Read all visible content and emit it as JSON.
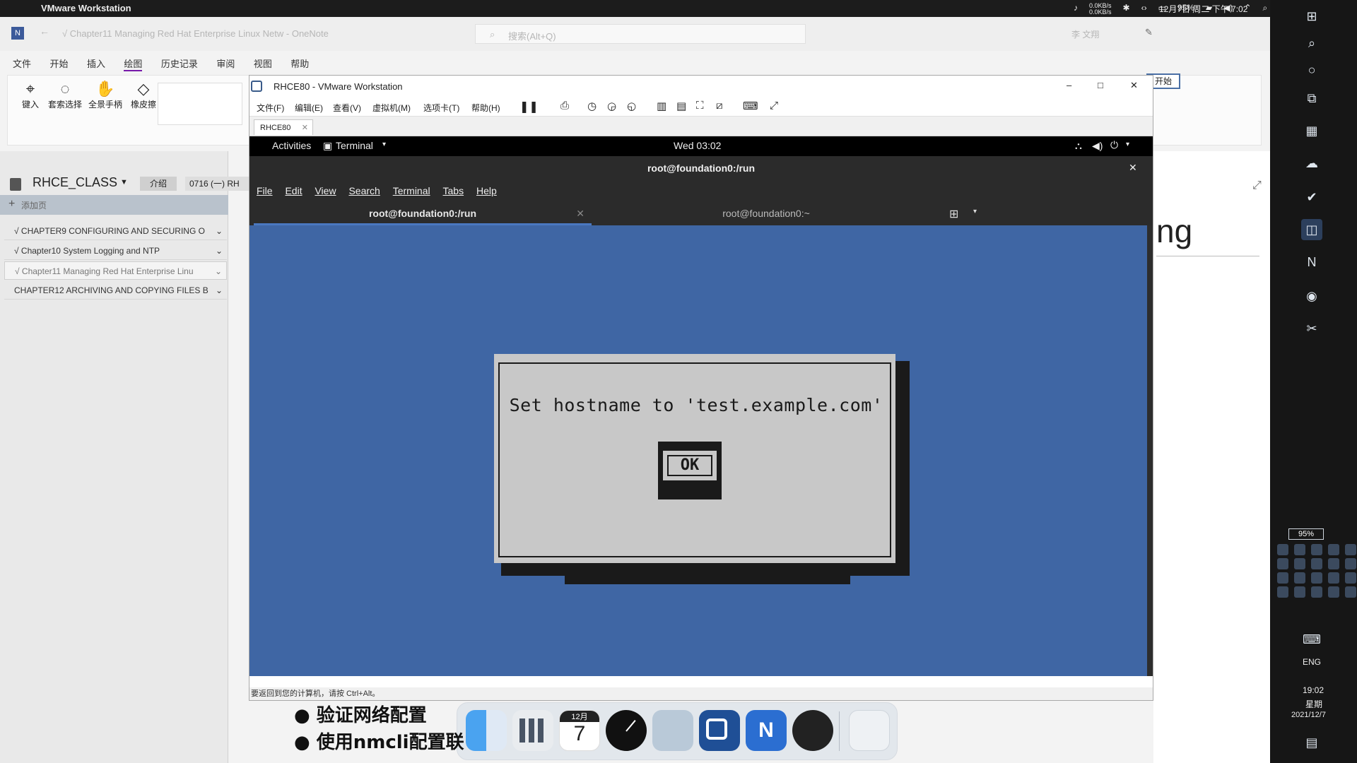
{
  "macbar": {
    "app_name": "VMware Workstation",
    "net_up": "0.0KB/s",
    "net_down": "0.0KB/s",
    "battery": "95%",
    "datetime": "12月7日 周二 下午 7:02"
  },
  "onenote": {
    "window_title": "√ Chapter11 Managing Red Hat Enterprise Linux Netw - OneNote",
    "search_placeholder": "搜索(Alt+Q)",
    "user": "李 文翔",
    "menu": [
      "文件",
      "开始",
      "插入",
      "绘图",
      "历史记录",
      "审阅",
      "视图",
      "帮助"
    ],
    "ribbon_tools": [
      "键入",
      "套索选择",
      "全景手柄",
      "橡皮擦"
    ],
    "notebook": "RHCE_CLASS",
    "section_tabs": [
      "介绍",
      "0716 (一) RH"
    ],
    "add_page": "添加页",
    "sections": [
      "√ CHAPTER9 CONFIGURING AND SECURING O",
      "√ Chapter10 System Logging and NTP",
      "√ Chapter11 Managing Red Hat Enterprise Linu",
      "CHAPTER12 ARCHIVING AND COPYING FILES B"
    ],
    "page_fragment": "ng",
    "start_button": "开始"
  },
  "vmware": {
    "title": "RHCE80 - VMware Workstation",
    "menu": [
      "文件(F)",
      "编辑(E)",
      "查看(V)",
      "虚拟机(M)",
      "选项卡(T)",
      "帮助(H)"
    ],
    "vm_tab": "RHCE80",
    "status_text": "要返回到您的计算机，请按 Ctrl+Alt。"
  },
  "guest": {
    "activities": "Activities",
    "app_menu": "Terminal",
    "clock": "Wed 03:02",
    "terminal_title": "root@foundation0:/run",
    "terminal_menu": [
      "File",
      "Edit",
      "View",
      "Search",
      "Terminal",
      "Tabs",
      "Help"
    ],
    "tabs": [
      "root@foundation0:/run",
      "root@foundation0:~"
    ],
    "dialog_message": "Set hostname to 'test.example.com'",
    "ok_label": "OK"
  },
  "dock": {
    "calendar_month": "12月",
    "calendar_day": "7"
  },
  "subtitles": [
    "验证网络配置",
    "使用nmcli配置联"
  ],
  "taskbar": {
    "battery": "95%",
    "lang": "ENG",
    "time": "19:02",
    "day": "星期",
    "date": "2021/12/7"
  }
}
